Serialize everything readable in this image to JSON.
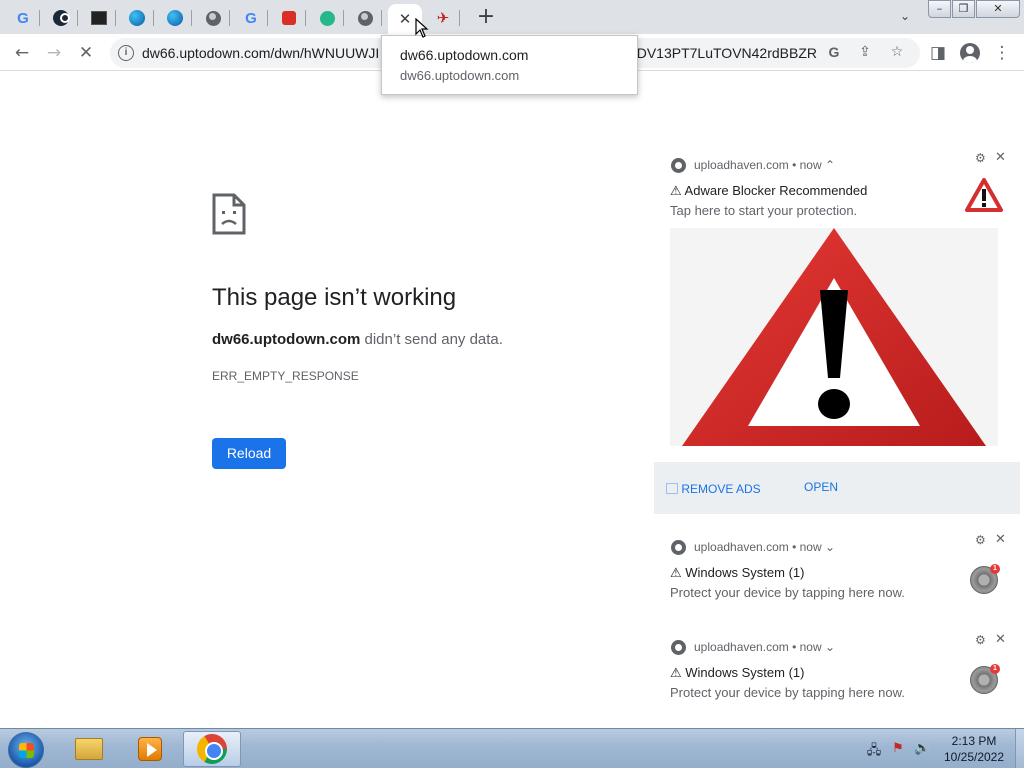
{
  "tabs": [
    {
      "icon": "google-g-icon",
      "glyph": "G"
    },
    {
      "icon": "steam-icon",
      "glyph": ""
    },
    {
      "icon": "image-thumbnail-icon",
      "glyph": ""
    },
    {
      "icon": "edge-icon",
      "glyph": ""
    },
    {
      "icon": "edge-icon",
      "glyph": ""
    },
    {
      "icon": "globe-icon",
      "glyph": ""
    },
    {
      "icon": "google-g-icon",
      "glyph": "G"
    },
    {
      "icon": "red-lock-icon",
      "glyph": ""
    },
    {
      "icon": "green-icon",
      "glyph": ""
    },
    {
      "icon": "globe-icon",
      "glyph": ""
    },
    {
      "icon": "loading-icon",
      "glyph": ""
    },
    {
      "icon": "tools-icon",
      "glyph": "✈"
    }
  ],
  "toolbar": {
    "url_left": "dw66.uptodown.com/dwn/hWNUUWJI",
    "url_right": "DV13PT7LuTOVN42rdBBZR...",
    "google_glyph": "G"
  },
  "hover_card": {
    "title": "dw66.uptodown.com",
    "domain": "dw66.uptodown.com"
  },
  "error_page": {
    "title": "This page isn’t working",
    "host": "dw66.uptodown.com",
    "message": " didn’t send any data.",
    "code": "ERR_EMPTY_RESPONSE",
    "reload_label": "Reload"
  },
  "notifications": [
    {
      "source": "uploadhaven.com",
      "time": "now",
      "title": "⚠ Adware Blocker Recommended",
      "message": "Tap here to start your protection.",
      "actions": [
        "⃞ REMOVE ADS",
        "OPEN"
      ]
    },
    {
      "source": "uploadhaven.com",
      "time": "now",
      "title": "⚠ Windows System (1)",
      "message": "Protect your device by tapping here now.",
      "badge": "1"
    },
    {
      "source": "uploadhaven.com",
      "time": "now",
      "title": "⚠ Windows System (1)",
      "message": "Protect your device by tapping here now.",
      "badge": "1"
    }
  ],
  "taskbar": {
    "time": "2:13 PM",
    "date": "10/25/2022"
  },
  "colors": {
    "accent": "#1a73e8",
    "warning_red": "#d32f2f",
    "taskbar": "#a5bcd6"
  }
}
